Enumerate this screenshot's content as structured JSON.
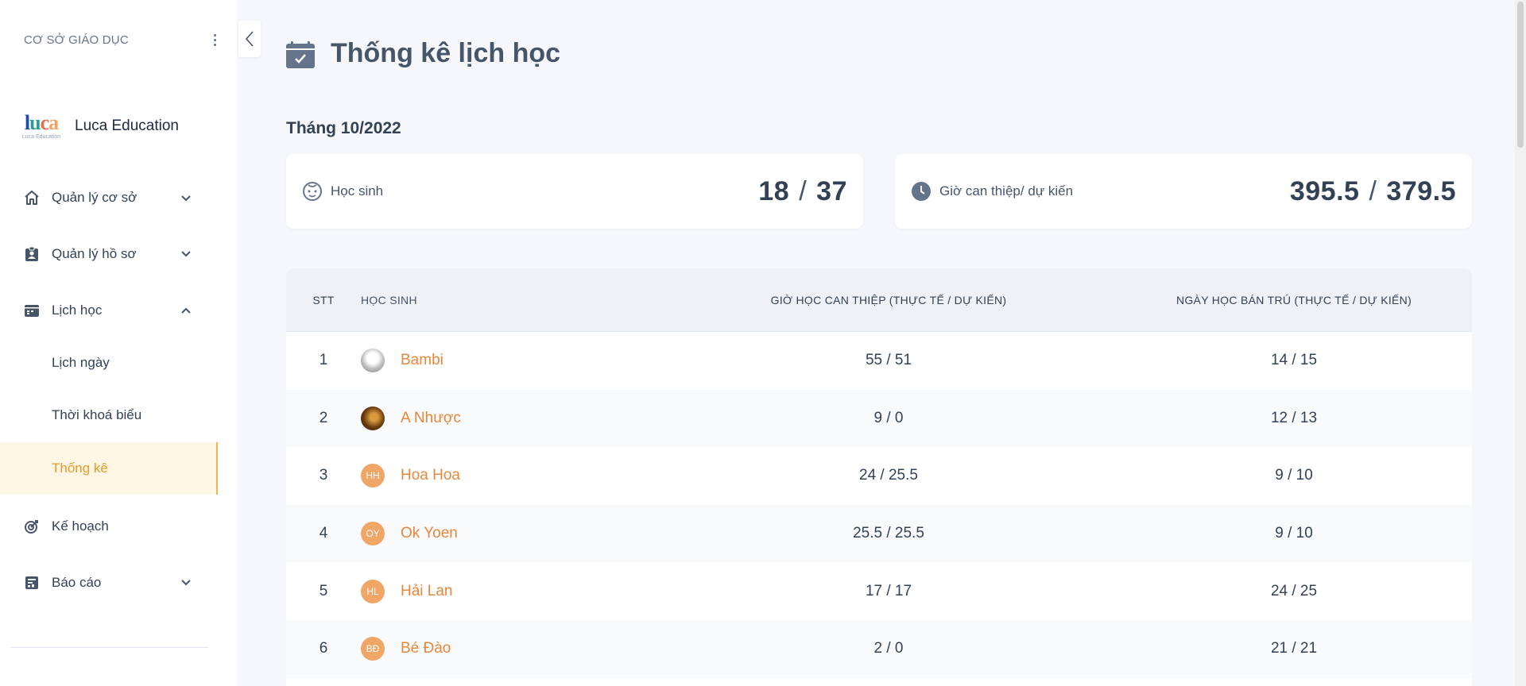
{
  "sidebar": {
    "org_label": "CƠ SỞ GIÁO DỤC",
    "brand": {
      "logo_text": "luca",
      "logo_sub": "Luca Education",
      "name": "Luca Education"
    },
    "nav": [
      {
        "label": "Quản lý cơ sở",
        "icon": "home-icon",
        "expanded": false
      },
      {
        "label": "Quản lý hồ sơ",
        "icon": "id-badge-icon",
        "expanded": false
      },
      {
        "label": "Lịch học",
        "icon": "calendar-icon",
        "expanded": true,
        "children": [
          {
            "label": "Lịch ngày",
            "active": false
          },
          {
            "label": "Thời khoá biểu",
            "active": false
          },
          {
            "label": "Thống kê",
            "active": true
          }
        ]
      },
      {
        "label": "Kế hoạch",
        "icon": "target-icon"
      },
      {
        "label": "Báo cáo",
        "icon": "report-icon",
        "expanded": false
      }
    ]
  },
  "page": {
    "title": "Thống kê lịch học",
    "month": "Tháng 10/2022"
  },
  "stats": {
    "students": {
      "label": "Học sinh",
      "actual": "18",
      "planned": "37",
      "sep": "/"
    },
    "hours": {
      "label": "Giờ can thiệp/ dự kiến",
      "actual": "395.5",
      "planned": "379.5",
      "sep": "/"
    }
  },
  "table": {
    "headers": {
      "stt": "STT",
      "student": "HỌC SINH",
      "hours": "GIỜ HỌC CAN THIỆP (THỰC TẾ / DỰ KIẾN)",
      "days": "NGÀY HỌC BÁN TRÚ (THỰC TẾ / DỰ KIẾN)"
    },
    "rows": [
      {
        "stt": "1",
        "name": "Bambi",
        "initials": "",
        "hours": "55 / 51",
        "days": "14 / 15"
      },
      {
        "stt": "2",
        "name": "A Nhược",
        "initials": "",
        "hours": "9 / 0",
        "days": "12 / 13"
      },
      {
        "stt": "3",
        "name": "Hoa Hoa",
        "initials": "HH",
        "hours": "24 / 25.5",
        "days": "9 / 10"
      },
      {
        "stt": "4",
        "name": "Ok Yoen",
        "initials": "OY",
        "hours": "25.5 / 25.5",
        "days": "9 / 10"
      },
      {
        "stt": "5",
        "name": "Hải Lan",
        "initials": "HL",
        "hours": "17 / 17",
        "days": "24 / 25"
      },
      {
        "stt": "6",
        "name": "Bé Đào",
        "initials": "BĐ",
        "hours": "2 / 0",
        "days": "21 / 21"
      }
    ]
  },
  "colors": {
    "accent": "#e8863a",
    "active_bg": "#fff6e6",
    "active_text": "#e89a2c",
    "avatar_bg": "#f0a666"
  }
}
